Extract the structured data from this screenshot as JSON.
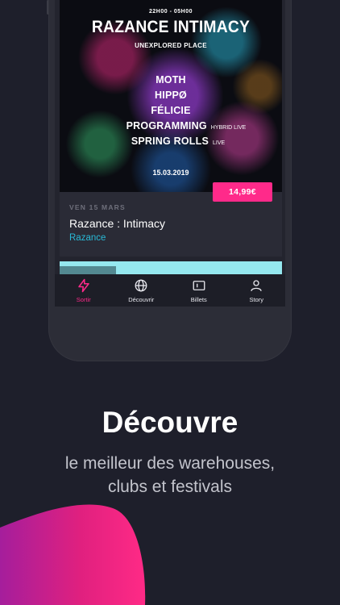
{
  "poster": {
    "time": "22H00 - 05H00",
    "title": "RAZANCE INTIMACY",
    "subtitle": "UNEXPLORED PLACE",
    "lineup": [
      {
        "name": "MOTH",
        "tag": ""
      },
      {
        "name": "HIPPØ",
        "tag": ""
      },
      {
        "name": "FÉLICIE",
        "tag": ""
      },
      {
        "name": "PROGRAMMING",
        "tag": "HYBRID LIVE"
      },
      {
        "name": "SPRING ROLLS",
        "tag": "LIVE"
      }
    ],
    "date": "15.03.2019"
  },
  "event": {
    "price": "14,99€",
    "date": "VEN 15 MARS",
    "title": "Razance : Intimacy",
    "venue": "Razance"
  },
  "nav": {
    "items": [
      {
        "label": "Sortir",
        "icon": "bolt-icon",
        "active": true
      },
      {
        "label": "Découvrir",
        "icon": "globe-icon",
        "active": false
      },
      {
        "label": "Billets",
        "icon": "ticket-icon",
        "active": false
      },
      {
        "label": "Story",
        "icon": "user-icon",
        "active": false
      }
    ]
  },
  "marketing": {
    "headline": "Découvre",
    "subline_1": "le meilleur des warehouses,",
    "subline_2": "clubs et festivals"
  },
  "colors": {
    "background": "#1e1f2b",
    "accent": "#ff2a8a",
    "venue": "#29b9d6"
  }
}
